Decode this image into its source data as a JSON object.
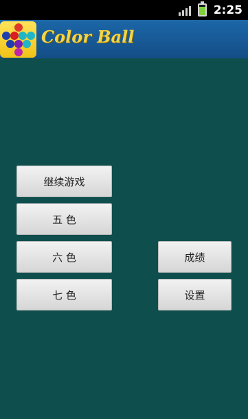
{
  "status_bar": {
    "time": "2:25",
    "icons": [
      "signal-icon",
      "battery-charging-icon"
    ]
  },
  "app_bar": {
    "title": "Color Ball",
    "icon": "color-ball-app-icon",
    "icon_colors": [
      "#1f3fae",
      "#d81e1e",
      "#21b5c8",
      "#c024a8",
      "#e03a2a",
      "#7a1db0"
    ]
  },
  "menu": {
    "continue_label": "继续游戏",
    "five_colors_label": "五 色",
    "six_colors_label": "六 色",
    "seven_colors_label": "七 色",
    "scores_label": "成绩",
    "settings_label": "设置"
  },
  "colors": {
    "background": "#0e4f4e",
    "app_bar": "#1a5f9e",
    "title": "#f2d54a",
    "button": "#e6e6e6"
  }
}
